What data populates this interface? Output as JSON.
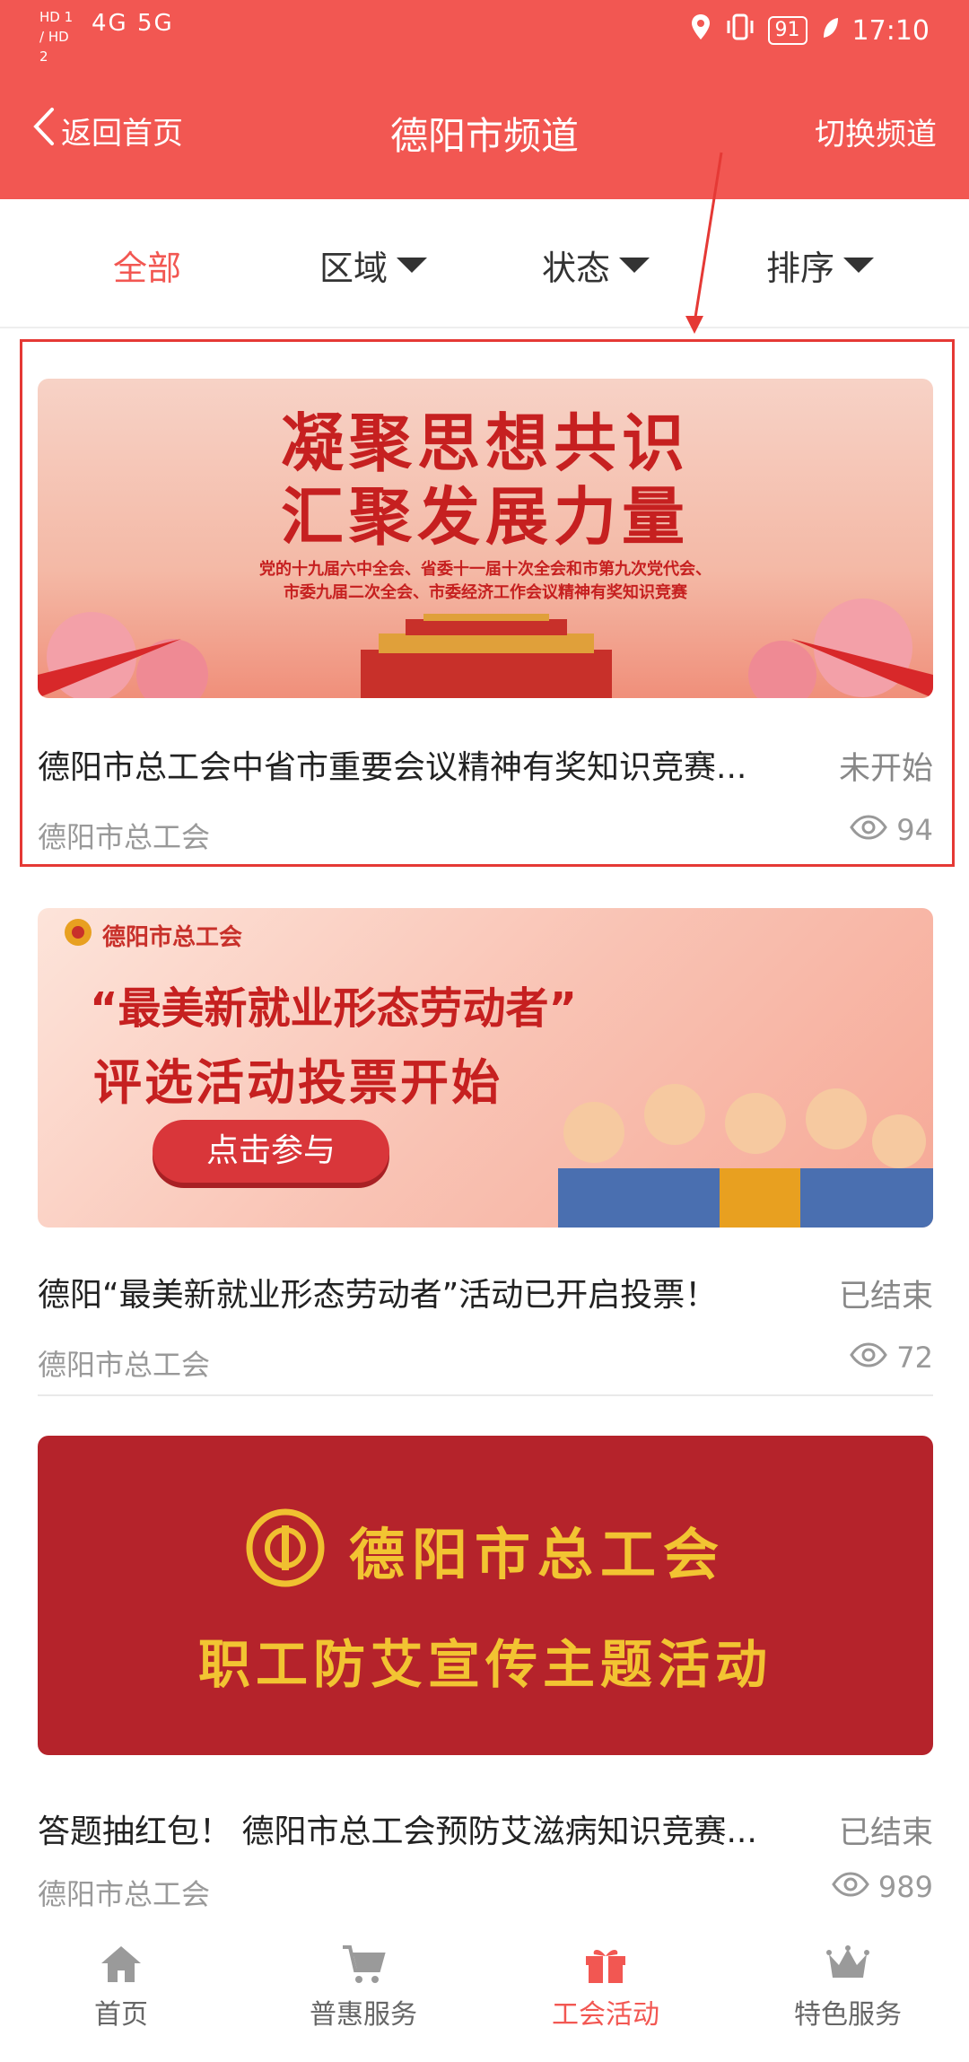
{
  "status_bar": {
    "left_labels": "HD 1 / HD 2",
    "network": "4G 5G",
    "battery": "91",
    "time": "17:10"
  },
  "header": {
    "back_label": "返回首页",
    "title": "德阳市频道",
    "switch_label": "切换频道"
  },
  "filters": {
    "all": "全部",
    "region": "区域",
    "status": "状态",
    "sort": "排序"
  },
  "cards": [
    {
      "banner_line1": "凝聚思想共识",
      "banner_line2": "汇聚发展力量",
      "banner_sub1": "党的十九届六中全会、省委十一届十次全会和市第九次党代会、",
      "banner_sub2": "市委九届二次全会、市委经济工作会议精神有奖知识竞赛",
      "title": "德阳市总工会中省市重要会议精神有奖知识竞赛...",
      "status": "未开始",
      "org": "德阳市总工会",
      "views": "94"
    },
    {
      "banner_org": "德阳市总工会",
      "banner_line1": "“最美新就业形态劳动者”",
      "banner_line2": "评选活动投票开始",
      "banner_button": "点击参与",
      "title": "德阳“最美新就业形态劳动者”活动已开启投票！",
      "status": "已结束",
      "org": "德阳市总工会",
      "views": "72"
    },
    {
      "banner_line1": "德阳市总工会",
      "banner_line2": "职工防艾宣传主题活动",
      "title": "答题抽红包！ 德阳市总工会预防艾滋病知识竞赛...",
      "status": "已结束",
      "org": "德阳市总工会",
      "views": "989"
    }
  ],
  "tabbar": {
    "home": "首页",
    "benefits": "普惠服务",
    "union": "工会活动",
    "special": "特色服务"
  },
  "colors": {
    "brand": "#f25752",
    "highlight": "#e53935"
  }
}
